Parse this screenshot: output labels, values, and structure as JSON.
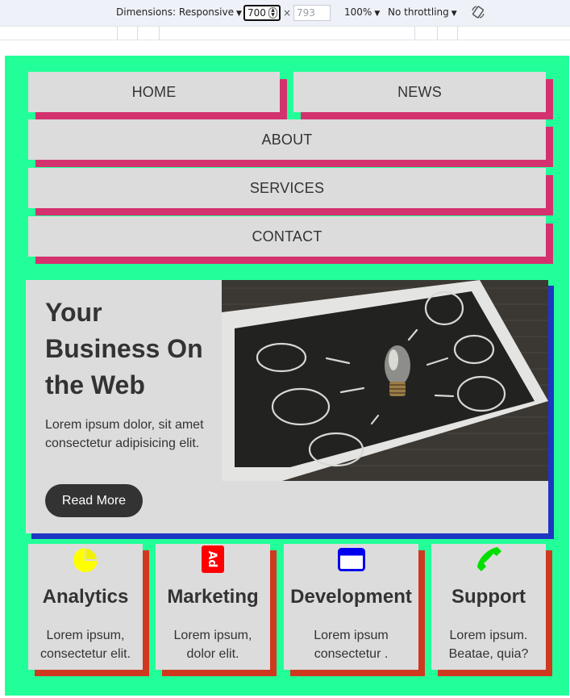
{
  "devtools": {
    "dimensions_label": "Dimensions: Responsive",
    "width_value": "700",
    "times": "×",
    "height_placeholder": "793",
    "zoom": "100%",
    "throttling": "No throttling"
  },
  "nav": {
    "home": "HOME",
    "news": "NEWS",
    "about": "ABOUT",
    "services": "SERVICES",
    "contact": "CONTACT"
  },
  "hero": {
    "title": "Your Business On the Web",
    "text": "Lorem ipsum dolor, sit amet consectetur adipisicing elit.",
    "button": "Read More"
  },
  "cards": [
    {
      "icon": "pie-chart-icon",
      "title": "Analytics",
      "text": "Lorem ipsum, consectetur elit."
    },
    {
      "icon": "ad-icon",
      "title": "Marketing",
      "text": "Lorem ipsum, dolor elit."
    },
    {
      "icon": "browser-window-icon",
      "title": "Development",
      "text": "Lorem ipsum consectetur ."
    },
    {
      "icon": "phone-icon",
      "title": "Support",
      "text": "Lorem ipsum. Beatae, quia?"
    }
  ],
  "colors": {
    "page_bg": "#22ff99",
    "button_face": "#dcdcdc",
    "nav_shadow": "#d4326f",
    "hero_shadow": "#1d37c2",
    "card_shadow": "#cf3920",
    "analytics_icon": "#ffff00",
    "marketing_icon": "#ff0000",
    "development_icon": "#0000ee",
    "support_icon": "#00e000"
  }
}
